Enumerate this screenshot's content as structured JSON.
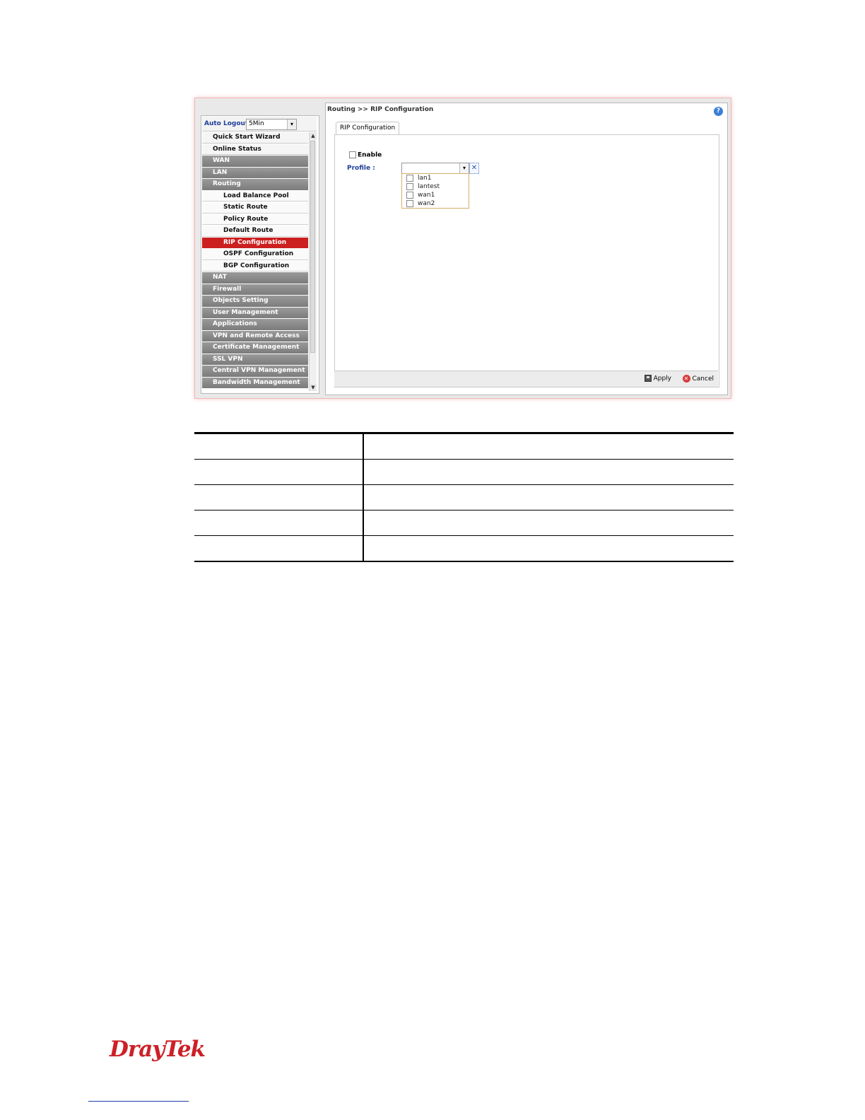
{
  "sidebar": {
    "auto_logout_label": "Auto Logout :",
    "auto_logout_value": "5Min",
    "items": [
      {
        "label": "Quick Start Wizard",
        "style": "light"
      },
      {
        "label": "Online Status",
        "style": "light"
      },
      {
        "label": "WAN",
        "style": "dark"
      },
      {
        "label": "LAN",
        "style": "dark"
      },
      {
        "label": "Routing",
        "style": "dark"
      },
      {
        "label": "Load Balance Pool",
        "style": "sub"
      },
      {
        "label": "Static Route",
        "style": "sub"
      },
      {
        "label": "Policy Route",
        "style": "sub"
      },
      {
        "label": "Default Route",
        "style": "sub"
      },
      {
        "label": "RIP Configuration",
        "style": "active"
      },
      {
        "label": "OSPF Configuration",
        "style": "sub"
      },
      {
        "label": "BGP Configuration",
        "style": "sub"
      },
      {
        "label": "NAT",
        "style": "dark"
      },
      {
        "label": "Firewall",
        "style": "dark"
      },
      {
        "label": "Objects Setting",
        "style": "dark"
      },
      {
        "label": "User Management",
        "style": "dark"
      },
      {
        "label": "Applications",
        "style": "dark"
      },
      {
        "label": "VPN and Remote Access",
        "style": "dark"
      },
      {
        "label": "Certificate Management",
        "style": "dark"
      },
      {
        "label": "SSL VPN",
        "style": "dark"
      },
      {
        "label": "Central VPN Management",
        "style": "dark"
      },
      {
        "label": "Bandwidth Management",
        "style": "dark"
      }
    ]
  },
  "main": {
    "breadcrumb": "Routing >> RIP Configuration",
    "tab_label": "RIP Configuration",
    "enable_label": "Enable",
    "profile_label": "Profile :",
    "profile_options": [
      "lan1",
      "lantest",
      "wan1",
      "wan2"
    ],
    "apply_label": "Apply",
    "cancel_label": "Cancel"
  },
  "footer": {
    "logo_text": "DrayTek"
  },
  "colors": {
    "active_menu": "#cc1f1f",
    "label_blue": "#1f3f9a",
    "logo_red": "#cc2027"
  }
}
